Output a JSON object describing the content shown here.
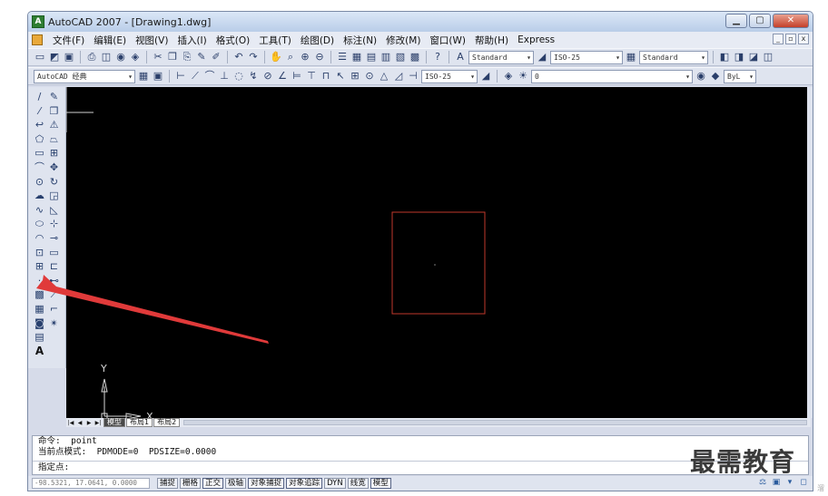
{
  "window": {
    "title": "AutoCAD 2007 - [Drawing1.dwg]",
    "app_icon_label": "A",
    "buttons": [
      "▁",
      "▢",
      "✕"
    ],
    "mdi_buttons": [
      "_",
      "▫",
      "x"
    ]
  },
  "menubar": {
    "items": [
      "文件(F)",
      "编辑(E)",
      "视图(V)",
      "插入(I)",
      "格式(O)",
      "工具(T)",
      "绘图(D)",
      "标注(N)",
      "修改(M)",
      "窗口(W)",
      "帮助(H)",
      "Express"
    ]
  },
  "toolbar1": {
    "text_style": "Standard",
    "dim_style": "ISO-25",
    "table_style": "Standard"
  },
  "toolbar2": {
    "workspace": "AutoCAD 经典",
    "dim_style": "ISO-25",
    "layer": "0",
    "color": "ByL"
  },
  "palette": {
    "text_tool": "A"
  },
  "drawing": {
    "ucs_y": "Y",
    "ucs_x": "X",
    "rectangle_color": "#c0392b",
    "arrow_color": "#e03a3a"
  },
  "tabs": {
    "nav": [
      "|◀",
      "◀",
      "▶",
      "▶|"
    ],
    "items": [
      "模型",
      "布局1",
      "布局2"
    ]
  },
  "command": {
    "line1": "命令:  point",
    "line2": "当前点模式:  PDMODE=0  PDSIZE=0.0000",
    "prompt": "指定点:"
  },
  "status": {
    "coords": "-98.5321, 17.0641, 0.0000",
    "toggles": [
      "捕捉",
      "栅格",
      "正交",
      "极轴",
      "对象捕捉",
      "对象追踪",
      "DYN",
      "线宽",
      "模型"
    ]
  },
  "watermark": {
    "text": "最需教育",
    "tail": "溜"
  }
}
